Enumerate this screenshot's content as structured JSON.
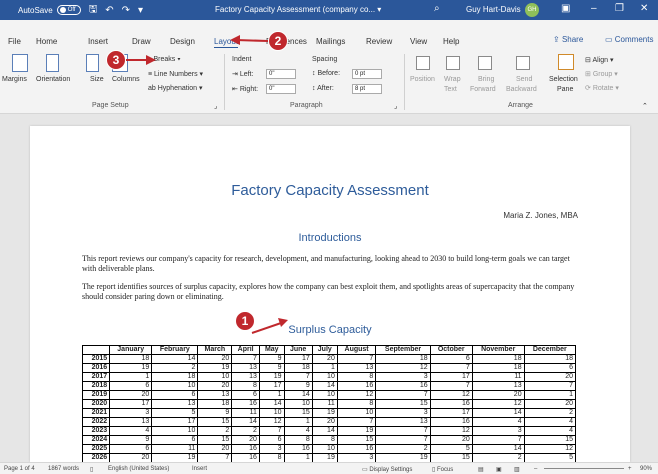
{
  "titlebar": {
    "autosave_label": "AutoSave",
    "autosave_state": "Off",
    "doc_title": "Factory Capacity Assessment (company co...",
    "user_name": "Guy Hart-Davis",
    "user_initials": "GH"
  },
  "menu": {
    "tabs": [
      "File",
      "Home",
      "Insert",
      "Draw",
      "Design",
      "Layout",
      "References",
      "Mailings",
      "Review",
      "View",
      "Help"
    ],
    "active_tab": "Layout",
    "share": "Share",
    "comments": "Comments"
  },
  "ribbon": {
    "page_setup": {
      "margins": "Margins",
      "orientation": "Orientation",
      "size": "Size",
      "columns": "Columns",
      "breaks": "Breaks",
      "line_numbers": "Line Numbers",
      "hyphenation": "Hyphenation",
      "label": "Page Setup"
    },
    "paragraph": {
      "indent_label": "Indent",
      "left_label": "Left:",
      "left_value": "0\"",
      "right_label": "Right:",
      "right_value": "0\"",
      "spacing_label": "Spacing",
      "before_label": "Before:",
      "before_value": "0 pt",
      "after_label": "After:",
      "after_value": "8 pt",
      "label": "Paragraph"
    },
    "arrange": {
      "position": "Position",
      "wrap_text_1": "Wrap",
      "wrap_text_2": "Text",
      "bring_forward_1": "Bring",
      "bring_forward_2": "Forward",
      "send_backward_1": "Send",
      "send_backward_2": "Backward",
      "selection_pane_1": "Selection",
      "selection_pane_2": "Pane",
      "align": "Align",
      "group": "Group",
      "rotate": "Rotate",
      "label": "Arrange"
    }
  },
  "document": {
    "title": "Factory Capacity Assessment",
    "author": "Maria Z. Jones, MBA",
    "heading1": "Introductions",
    "para1": "This report reviews our company's capacity for research, development, and manufacturing, looking ahead to 2030 to build long-term goals we can target with deliverable plans.",
    "para2": "The report identifies sources of surplus capacity, explores how the company can best exploit them, and spotlights areas of supercapacity that the company should consider paring down or eliminating.",
    "heading2": "Surplus Capacity",
    "table": {
      "headers": [
        "",
        "January",
        "February",
        "March",
        "April",
        "May",
        "June",
        "July",
        "August",
        "September",
        "October",
        "November",
        "December"
      ],
      "rows": [
        [
          "2015",
          "18",
          "14",
          "20",
          "7",
          "9",
          "17",
          "20",
          "7",
          "18",
          "6",
          "18",
          "18"
        ],
        [
          "2016",
          "19",
          "2",
          "19",
          "13",
          "9",
          "18",
          "1",
          "13",
          "12",
          "7",
          "18",
          "6"
        ],
        [
          "2017",
          "1",
          "18",
          "10",
          "13",
          "19",
          "7",
          "10",
          "8",
          "3",
          "17",
          "11",
          "20"
        ],
        [
          "2018",
          "6",
          "10",
          "20",
          "8",
          "17",
          "9",
          "14",
          "16",
          "16",
          "7",
          "13",
          "7"
        ],
        [
          "2019",
          "20",
          "6",
          "13",
          "6",
          "1",
          "14",
          "10",
          "12",
          "7",
          "12",
          "20",
          "1"
        ],
        [
          "2020",
          "17",
          "13",
          "18",
          "16",
          "14",
          "10",
          "11",
          "8",
          "15",
          "16",
          "12",
          "20"
        ],
        [
          "2021",
          "3",
          "5",
          "9",
          "11",
          "10",
          "15",
          "19",
          "10",
          "3",
          "17",
          "14",
          "2"
        ],
        [
          "2022",
          "13",
          "17",
          "15",
          "14",
          "12",
          "1",
          "20",
          "7",
          "13",
          "16",
          "4",
          "4"
        ],
        [
          "2023",
          "4",
          "10",
          "2",
          "2",
          "7",
          "4",
          "14",
          "19",
          "7",
          "12",
          "3",
          "4"
        ],
        [
          "2024",
          "9",
          "6",
          "15",
          "20",
          "6",
          "8",
          "8",
          "15",
          "7",
          "20",
          "7",
          "15"
        ],
        [
          "2025",
          "6",
          "11",
          "20",
          "16",
          "3",
          "16",
          "10",
          "16",
          "2",
          "5",
          "14",
          "12"
        ],
        [
          "2026",
          "20",
          "19",
          "7",
          "16",
          "8",
          "1",
          "19",
          "3",
          "19",
          "15",
          "2",
          "5"
        ]
      ]
    }
  },
  "status": {
    "page": "Page 1 of 4",
    "words": "1867 words",
    "language": "English (United States)",
    "mode": "Insert",
    "display_settings": "Display Settings",
    "focus": "Focus",
    "zoom": "90%"
  },
  "callouts": [
    "1",
    "2",
    "3"
  ]
}
